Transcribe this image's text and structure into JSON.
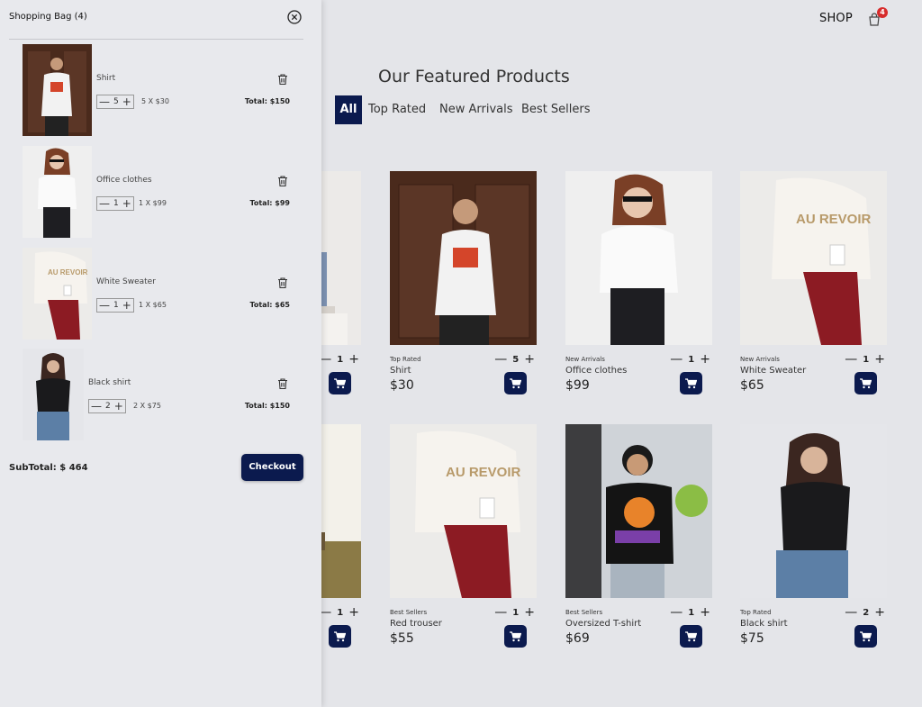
{
  "header": {
    "shop_label": "SHOP",
    "cart_count": "4",
    "cart_icon": "shopping-bag-icon"
  },
  "featured": {
    "title": "Our Featured Products"
  },
  "filters": [
    {
      "label": "All",
      "active": true
    },
    {
      "label": "Top Rated",
      "active": false
    },
    {
      "label": "New Arrivals",
      "active": false
    },
    {
      "label": "Best Sellers",
      "active": false
    }
  ],
  "products": [
    {
      "category": "",
      "name": "",
      "price": "",
      "qty": "1"
    },
    {
      "category": "Top Rated",
      "name": "Shirt",
      "price": "$30",
      "qty": "5"
    },
    {
      "category": "New Arrivals",
      "name": "Office clothes",
      "price": "$99",
      "qty": "1"
    },
    {
      "category": "New Arrivals",
      "name": "White Sweater",
      "price": "$65",
      "qty": "1"
    },
    {
      "category": "",
      "name": "",
      "price": "",
      "qty": "1"
    },
    {
      "category": "Best Sellers",
      "name": "Red trouser",
      "price": "$55",
      "qty": "1"
    },
    {
      "category": "Best Sellers",
      "name": "Oversized T-shirt",
      "price": "$69",
      "qty": "1"
    },
    {
      "category": "Top Rated",
      "name": "Black shirt",
      "price": "$75",
      "qty": "2"
    }
  ],
  "bag": {
    "title": "Shopping Bag (4)",
    "items": [
      {
        "name": "Shirt",
        "qty": "5",
        "unit": "5 X $30",
        "total": "Total: $150"
      },
      {
        "name": "Office clothes",
        "qty": "1",
        "unit": "1 X $99",
        "total": "Total: $99"
      },
      {
        "name": "White Sweater",
        "qty": "1",
        "unit": "1 X $65",
        "total": "Total: $65"
      },
      {
        "name": "Black shirt",
        "qty": "2",
        "unit": "2 X $75",
        "total": "Total: $150"
      }
    ],
    "subtotal": "SubTotal:  $ 464",
    "checkout_label": "Checkout"
  },
  "symbols": {
    "minus": "—",
    "plus": "+"
  },
  "colors": {
    "accent": "#0b1a4e",
    "badge": "#d72c2c",
    "background": "#e4e5e9"
  }
}
